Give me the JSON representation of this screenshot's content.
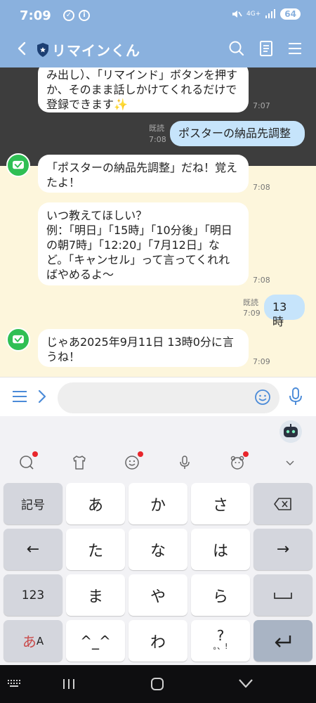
{
  "status": {
    "time": "7:09",
    "battery": "64",
    "network": "4G+"
  },
  "header": {
    "title": "リマインくん"
  },
  "messages": {
    "partial_bot": "み出し）、「リマインド」ボタンを押すか、そのまま話しかけてくれるだけで登録できます✨",
    "partial_bot_time": "7:07",
    "sent1": "ポスターの納品先調整",
    "sent1_read": "既読",
    "sent1_time": "7:08",
    "bot1": "「ポスターの納品先調整」だね！覚えたよ！",
    "bot1_time": "7:08",
    "bot2": "いつ教えてほしい？\n例：「明日」「15時」「10分後」「明日の朝7時」「12:20」「7月12日」など。「キャンセル」って言ってくれればやめるよ〜",
    "bot2_time": "7:08",
    "sent2": "13時",
    "sent2_read": "既読",
    "sent2_time": "7:09",
    "bot3": "じゃあ2025年9月11日 13時0分に言うね！",
    "bot3_time": "7:09"
  },
  "input": {
    "placeholder": ""
  },
  "keyboard": {
    "row1": [
      "記号",
      "あ",
      "か",
      "さ"
    ],
    "row2": [
      "←",
      "た",
      "な",
      "は",
      "→"
    ],
    "row3": [
      "123",
      "ま",
      "や",
      "ら"
    ],
    "row4_kana": "あ",
    "row4_latin": "A",
    "row4": [
      "^_^",
      "わ",
      "?",
      "。、!"
    ]
  },
  "colors": {
    "header": "#8ab1de",
    "chat_bg": "#fdf6dc",
    "sent_bubble": "#c6e4fb",
    "avatar": "#2fbf54"
  }
}
